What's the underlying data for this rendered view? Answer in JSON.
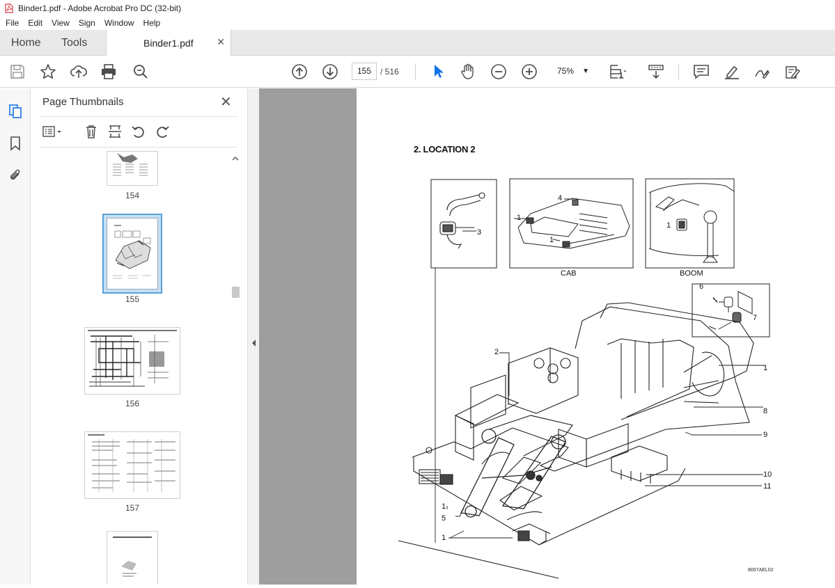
{
  "window": {
    "title": "Binder1.pdf - Adobe Acrobat Pro DC (32-bit)"
  },
  "menu": {
    "items": [
      "File",
      "Edit",
      "View",
      "Sign",
      "Window",
      "Help"
    ]
  },
  "tabs": {
    "home": "Home",
    "tools": "Tools",
    "document": "Binder1.pdf",
    "close_glyph": "✕"
  },
  "toolbar": {
    "icons": [
      "save-icon",
      "bookmark-star-icon",
      "share-upload-icon",
      "print-icon",
      "find-zoom-icon",
      "prev-page-icon",
      "next-page-icon",
      "select-cursor-icon",
      "hand-icon",
      "zoom-out-icon",
      "zoom-in-icon",
      "fit-page-icon",
      "scroll-mode-icon",
      "comment-icon",
      "highlight-icon",
      "draw-icon",
      "fill-sign-icon"
    ],
    "current_page": "155",
    "page_total": "/ 516",
    "zoom": "75%"
  },
  "thumbnails_panel": {
    "title": "Page Thumbnails",
    "close_glyph": "✕",
    "pages": [
      {
        "num": "154",
        "selected": false
      },
      {
        "num": "155",
        "selected": true
      },
      {
        "num": "156",
        "selected": false
      },
      {
        "num": "157",
        "selected": false
      },
      {
        "num": "",
        "selected": false
      }
    ]
  },
  "document": {
    "section_title": "2.  LOCATION 2",
    "captions": {
      "cab": "CAB",
      "boom": "BOOM"
    },
    "callouts": [
      "1",
      "2",
      "3",
      "4",
      "5",
      "6",
      "7",
      "8",
      "9",
      "10",
      "11"
    ],
    "drawing_id": "8007AEL02"
  },
  "colors": {
    "accent_blue": "#1473e6",
    "pdf_red": "#d7373f",
    "toolbar_icon": "#4b4b4b",
    "doc_background": "#9e9e9e",
    "tab_bar": "#e9e9e9"
  }
}
